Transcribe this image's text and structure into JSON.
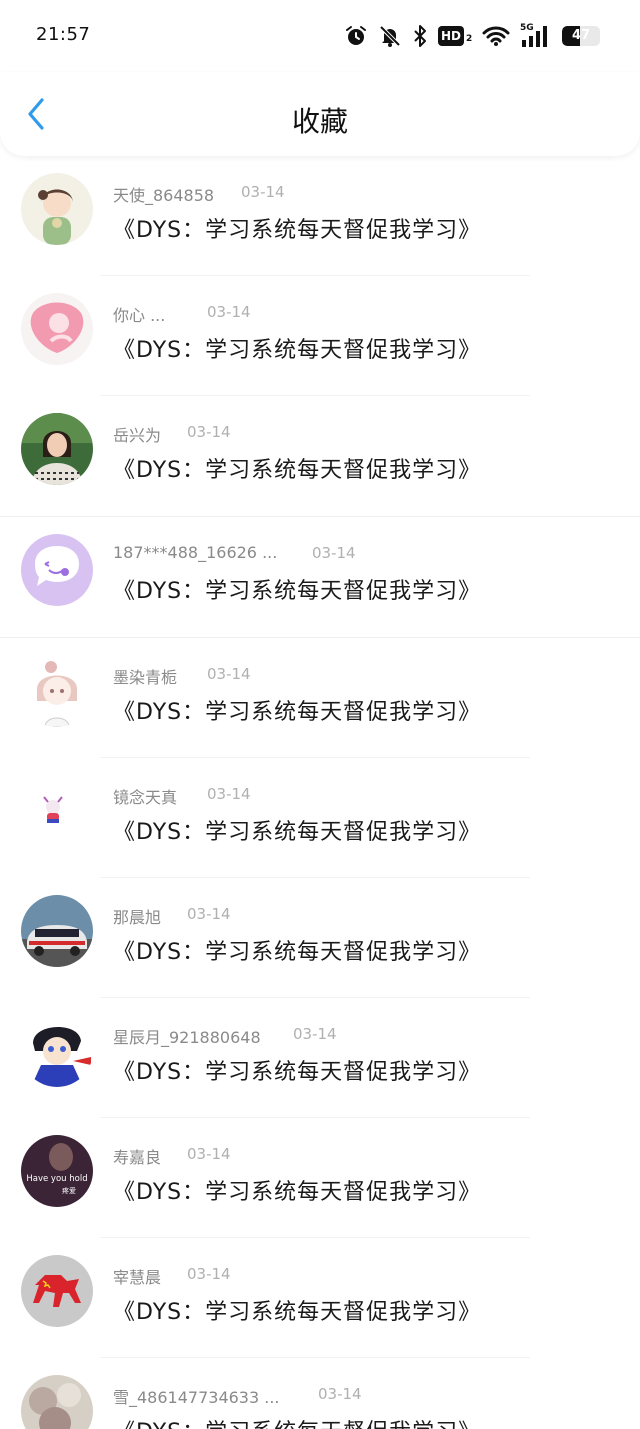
{
  "status_bar": {
    "time": "21:57",
    "icons": [
      "alarm-icon",
      "mute-bell-icon",
      "bluetooth-icon",
      "hd2-icon",
      "wifi-icon",
      "5g-signal-icon",
      "battery-icon"
    ],
    "hd_label": "HD",
    "hd_sub": "2",
    "network_label": "5G",
    "battery_level": "47",
    "battery_fraction": 0.47
  },
  "header": {
    "title": "收藏",
    "back_icon": "chevron-left-icon",
    "accent": "#2f9bea"
  },
  "favorites": [
    {
      "user": "天使_864858",
      "date": "03-14",
      "title": "《DYS：学习系统每天督促我学习》",
      "avatar": "girl-illustration"
    },
    {
      "user": "你心 ...",
      "date": "03-14",
      "title": "《DYS：学习系统每天督促我学习》",
      "avatar": "pink-heart"
    },
    {
      "user": "岳兴为",
      "date": "03-14",
      "title": "《DYS：学习系统每天督促我学习》",
      "avatar": "woman-photo"
    },
    {
      "user": "187***488_16626 ...",
      "date": "03-14",
      "title": "《DYS：学习系统每天督促我学习》",
      "avatar": "purple-chat"
    },
    {
      "user": "墨染青栀",
      "date": "03-14",
      "title": "《DYS：学习系统每天督促我学习》",
      "avatar": "anime-girl"
    },
    {
      "user": "镜念天真",
      "date": "03-14",
      "title": "《DYS：学习系统每天督促我学习》",
      "avatar": "small-figure"
    },
    {
      "user": "那晨旭",
      "date": "03-14",
      "title": "《DYS：学习系统每天督促我学习》",
      "avatar": "rally-car"
    },
    {
      "user": "星辰月_921880648",
      "date": "03-14",
      "title": "《DYS：学习系统每天督促我学习》",
      "avatar": "anime-boy"
    },
    {
      "user": "寿嘉良",
      "date": "03-14",
      "title": "《DYS：学习系统每天督促我学习》",
      "avatar": "have-you-hold"
    },
    {
      "user": "宰慧晨",
      "date": "03-14",
      "title": "《DYS：学习系统每天督促我学习》",
      "avatar": "red-horse"
    },
    {
      "user": "雪_486147734633 ...",
      "date": "03-14",
      "title": "《DYS：学习系统每天督促我学习》",
      "avatar": "blurry-photo"
    }
  ],
  "avatar_texts": {
    "have_you_hold": "Have you hold",
    "have_you_hold_cn": "疼爱"
  }
}
